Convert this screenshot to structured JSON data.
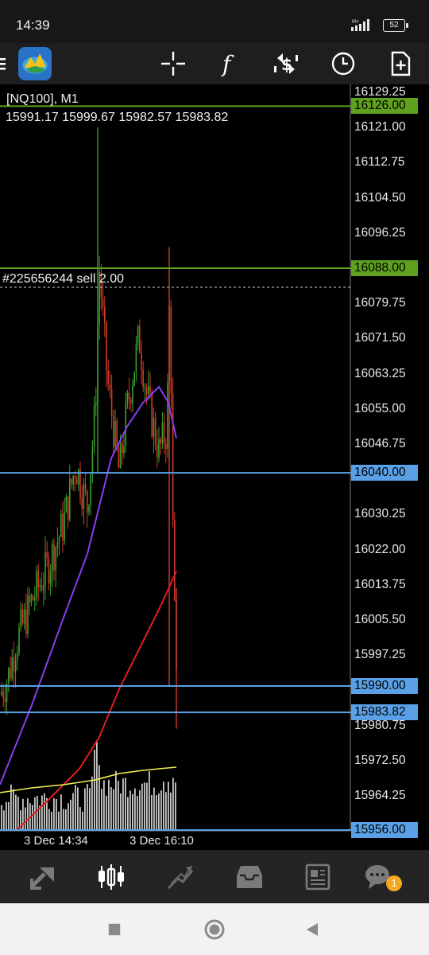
{
  "status_bar": {
    "time": "14:39",
    "network": "H+",
    "battery": "52"
  },
  "toolbar": {
    "menu_icon": "menu-icon",
    "logo_icon": "metatrader-logo-icon",
    "icons": [
      "crosshair-icon",
      "indicators-icon",
      "symbols-icon",
      "timeframe-icon",
      "new-order-icon"
    ],
    "indicator_glyph": "f"
  },
  "chart": {
    "symbol": "[NQ100], M1",
    "ohlc": "15991.17 15999.67 15982.57 15983.82",
    "order_label": "#225656244 sell  2.00",
    "price_scale": [
      "16129.25",
      "16121.00",
      "16112.75",
      "16104.50",
      "16096.25",
      "16079.75",
      "16071.50",
      "16063.25",
      "16055.00",
      "16046.75",
      "16030.25",
      "16022.00",
      "16013.75",
      "16005.50",
      "15997.25",
      "15980.75",
      "15972.50",
      "15964.25"
    ],
    "hlines": [
      {
        "price": "16126.00",
        "color": "#5fa01e"
      },
      {
        "price": "16088.00",
        "color": "#5fa01e"
      },
      {
        "price": "16040.00",
        "color": "#5aa0e6"
      },
      {
        "price": "15990.00",
        "color": "#5aa0e6"
      },
      {
        "price": "15983.82",
        "color": "#5aa0e6"
      },
      {
        "price": "15956.00",
        "color": "#5aa0e6"
      }
    ],
    "time_labels": [
      "3 Dec 14:34",
      "3 Dec 16:10"
    ],
    "colors": {
      "bull": "#3aa02a",
      "bear": "#d23a2a",
      "ma_fast": "#8a3cf0",
      "ma_slow": "#e01e1e",
      "volume": "#c8c8c8",
      "volume_ma": "#f0f050"
    }
  },
  "bottom_nav": {
    "items": [
      "quotes-icon",
      "chart-icon",
      "trade-icon",
      "history-icon",
      "news-icon",
      "messages-icon"
    ],
    "badge": "1"
  },
  "system_nav": [
    "recents-icon",
    "home-icon",
    "back-icon"
  ]
}
